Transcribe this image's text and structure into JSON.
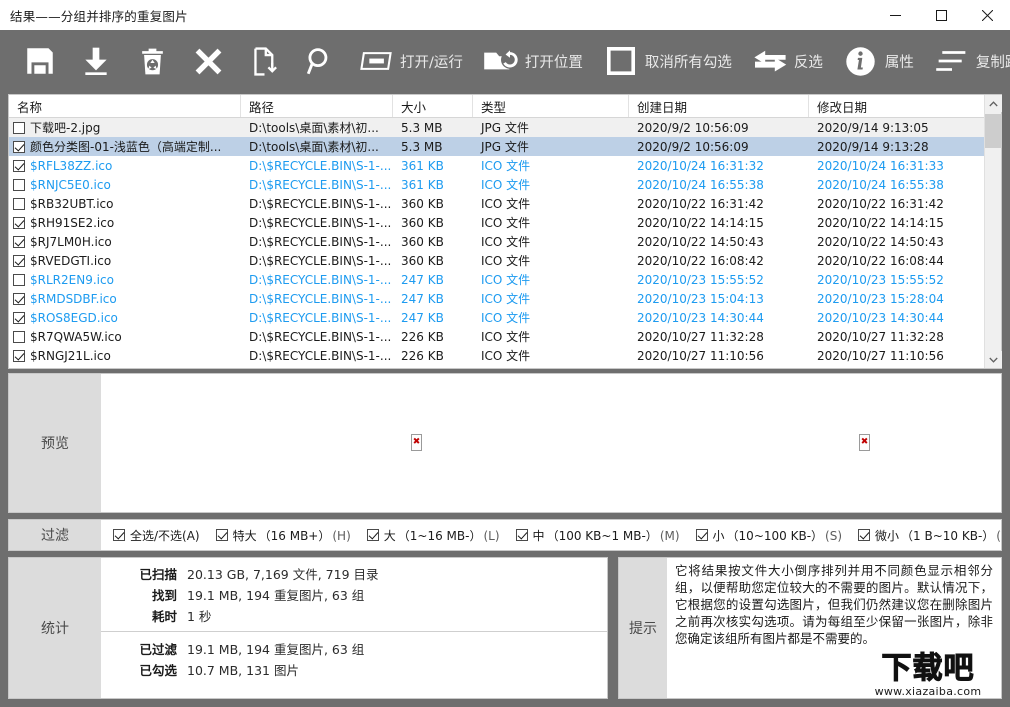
{
  "window": {
    "title": "结果——分组并排序的重复图片",
    "controls": {
      "minimize": "minimize-button",
      "maximize": "maximize-button",
      "close": "close-button"
    }
  },
  "toolbar": {
    "items": [
      {
        "icon": "save-icon",
        "label": ""
      },
      {
        "icon": "download-icon",
        "label": ""
      },
      {
        "icon": "recycle-bin-icon",
        "label": ""
      },
      {
        "icon": "delete-x-icon",
        "label": ""
      },
      {
        "icon": "move-file-icon",
        "label": ""
      },
      {
        "icon": "search-icon",
        "label": ""
      },
      {
        "icon": "open-run-icon",
        "label": "打开/运行"
      },
      {
        "icon": "open-location-icon",
        "label": "打开位置"
      },
      {
        "icon": "uncheck-all-icon",
        "label": "取消所有勾选"
      },
      {
        "icon": "invert-selection-icon",
        "label": "反选"
      },
      {
        "icon": "properties-info-icon",
        "label": "属性"
      },
      {
        "icon": "copy-path-icon",
        "label": "复制路径"
      }
    ]
  },
  "table": {
    "columns": [
      "名称",
      "路径",
      "大小",
      "类型",
      "创建日期",
      "修改日期"
    ],
    "rows": [
      {
        "checked": false,
        "style": "alt",
        "color": "dark",
        "name": "下载吧-2.jpg",
        "path": "D:\\tools\\桌面\\素材\\初...",
        "size": "5.3 MB",
        "type": "JPG 文件",
        "created": "2020/9/2 10:56:09",
        "modified": "2020/9/14 9:13:05"
      },
      {
        "checked": true,
        "style": "sel",
        "color": "dark",
        "name": "颜色分类图-01-浅蓝色（高端定制...",
        "path": "D:\\tools\\桌面\\素材\\初...",
        "size": "5.3 MB",
        "type": "JPG 文件",
        "created": "2020/9/2 10:56:09",
        "modified": "2020/9/14 9:13:28"
      },
      {
        "checked": true,
        "style": "",
        "color": "blue",
        "name": "$RFL38ZZ.ico",
        "path": "D:\\$RECYCLE.BIN\\S-1-...",
        "size": "361 KB",
        "type": "ICO 文件",
        "created": "2020/10/24 16:31:32",
        "modified": "2020/10/24 16:31:33"
      },
      {
        "checked": false,
        "style": "",
        "color": "blue",
        "name": "$RNJC5E0.ico",
        "path": "D:\\$RECYCLE.BIN\\S-1-...",
        "size": "361 KB",
        "type": "ICO 文件",
        "created": "2020/10/24 16:55:38",
        "modified": "2020/10/24 16:55:38"
      },
      {
        "checked": false,
        "style": "",
        "color": "dark",
        "name": "$RB32UBT.ico",
        "path": "D:\\$RECYCLE.BIN\\S-1-...",
        "size": "360 KB",
        "type": "ICO 文件",
        "created": "2020/10/22 16:31:42",
        "modified": "2020/10/22 16:31:42"
      },
      {
        "checked": true,
        "style": "",
        "color": "dark",
        "name": "$RH91SE2.ico",
        "path": "D:\\$RECYCLE.BIN\\S-1-...",
        "size": "360 KB",
        "type": "ICO 文件",
        "created": "2020/10/22 14:14:15",
        "modified": "2020/10/22 14:14:15"
      },
      {
        "checked": true,
        "style": "",
        "color": "dark",
        "name": "$RJ7LM0H.ico",
        "path": "D:\\$RECYCLE.BIN\\S-1-...",
        "size": "360 KB",
        "type": "ICO 文件",
        "created": "2020/10/22 14:50:43",
        "modified": "2020/10/22 14:50:43"
      },
      {
        "checked": true,
        "style": "",
        "color": "dark",
        "name": "$RVEDGTI.ico",
        "path": "D:\\$RECYCLE.BIN\\S-1-...",
        "size": "360 KB",
        "type": "ICO 文件",
        "created": "2020/10/22 16:08:42",
        "modified": "2020/10/22 16:08:44"
      },
      {
        "checked": false,
        "style": "",
        "color": "blue",
        "name": "$RLR2EN9.ico",
        "path": "D:\\$RECYCLE.BIN\\S-1-...",
        "size": "247 KB",
        "type": "ICO 文件",
        "created": "2020/10/23 15:55:52",
        "modified": "2020/10/23 15:55:52"
      },
      {
        "checked": true,
        "style": "",
        "color": "blue",
        "name": "$RMDSDBF.ico",
        "path": "D:\\$RECYCLE.BIN\\S-1-...",
        "size": "247 KB",
        "type": "ICO 文件",
        "created": "2020/10/23 15:04:13",
        "modified": "2020/10/23 15:28:04"
      },
      {
        "checked": true,
        "style": "",
        "color": "blue",
        "name": "$ROS8EGD.ico",
        "path": "D:\\$RECYCLE.BIN\\S-1-...",
        "size": "247 KB",
        "type": "ICO 文件",
        "created": "2020/10/23 14:30:44",
        "modified": "2020/10/23 14:30:44"
      },
      {
        "checked": false,
        "style": "",
        "color": "dark",
        "name": "$R7QWA5W.ico",
        "path": "D:\\$RECYCLE.BIN\\S-1-...",
        "size": "226 KB",
        "type": "ICO 文件",
        "created": "2020/10/27 11:32:28",
        "modified": "2020/10/27 11:32:28"
      },
      {
        "checked": true,
        "style": "",
        "color": "dark",
        "name": "$RNGJ21L.ico",
        "path": "D:\\$RECYCLE.BIN\\S-1-...",
        "size": "226 KB",
        "type": "ICO 文件",
        "created": "2020/10/27 11:10:56",
        "modified": "2020/10/27 11:10:56"
      }
    ]
  },
  "preview": {
    "label": "预览",
    "images": [
      {
        "name": "broken-image-placeholder",
        "glyph": "✖"
      },
      {
        "name": "broken-image-placeholder",
        "glyph": "✖"
      }
    ]
  },
  "filter": {
    "label": "过滤",
    "items": [
      {
        "checked": true,
        "text": "全选/不选(A)",
        "range": "",
        "key": ""
      },
      {
        "checked": true,
        "text": "特大",
        "range": "（16 MB+）",
        "key": "(H)"
      },
      {
        "checked": true,
        "text": "大",
        "range": "（1~16 MB-）",
        "key": "(L)"
      },
      {
        "checked": true,
        "text": "中",
        "range": "（100 KB~1 MB-）",
        "key": "(M)"
      },
      {
        "checked": true,
        "text": "小",
        "range": "（10~100 KB-）",
        "key": "(S)"
      },
      {
        "checked": true,
        "text": "微小",
        "range": "（1 B~10 KB-）",
        "key": "(T)"
      }
    ]
  },
  "stats": {
    "label": "统计",
    "group1": [
      {
        "key": "已扫描",
        "value": "20.13 GB, 7,169 文件, 719 目录"
      },
      {
        "key": "找到",
        "value": "19.1 MB, 194 重复图片, 63 组"
      },
      {
        "key": "耗时",
        "value": "1 秒"
      }
    ],
    "group2": [
      {
        "key": "已过滤",
        "value": "19.1 MB, 194 重复图片, 63 组"
      },
      {
        "key": "已勾选",
        "value": "10.7 MB, 131 图片"
      }
    ]
  },
  "tips": {
    "label": "提示",
    "text": "它将结果按文件大小倒序排列并用不同颜色显示相邻分组，以便帮助您定位较大的不需要的图片。默认情况下，它根据您的设置勾选图片，但我们仍然建议您在删除图片之前再次核实勾选项。请为每组至少保留一张图片，除非您确定该组所有图片都是不需要的。"
  },
  "watermark": {
    "main": "下载吧",
    "sub": "www.xiazaiba.com"
  },
  "colors": {
    "chrome": "#6e6e6e",
    "accent_blue": "#1d9bf0",
    "selection": "#bdd0e6",
    "panel_label": "#dcdcdc"
  }
}
